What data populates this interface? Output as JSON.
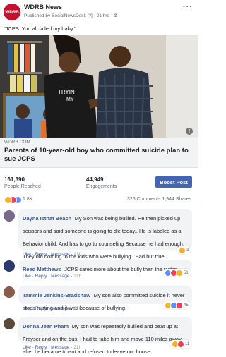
{
  "post": {
    "page_name": "WDRB News",
    "logo_text": "WDRB",
    "meta": "Published by SocialNewsDesk [?] · 21 hrs · ⚙",
    "more": "···",
    "text": "\"JCPS: You all failed my baby.\""
  },
  "photo": {
    "shirt_text_1": "TRYIN",
    "shirt_text_2": "MY",
    "info_icon": "i"
  },
  "link": {
    "domain": "WDRB.COM",
    "headline": "Parents of 10-year-old boy who committed suicide plan to sue JCPS"
  },
  "stats": {
    "reached_value": "161,390",
    "reached_label": "People Reached",
    "engagements_value": "44,949",
    "engagements_label": "Engagements",
    "boost_label": "Boost Post"
  },
  "reactions": {
    "count": "1.8K",
    "comments_shares": "326 Comments  1,944 Shares"
  },
  "comments": [
    {
      "name": "Dayna Isthat Beach",
      "text": "My Son was being bullied. He then picked up scissors and said someone is going to die today.. He is labeled as a Behavior child. And has to go to counseling Because he had enough. They did nothing to the kids who were bullying.. Sad but true.",
      "like": "Like",
      "reply": "Reply",
      "message": "Message",
      "time": "21h",
      "react_count": "3"
    },
    {
      "name": "Reed Matthews",
      "text": "JCPS cares more about the bully than the victim",
      "like": "Like",
      "reply": "Reply",
      "message": "Message",
      "time": "21h",
      "react_count": "51"
    },
    {
      "name": "Tammie Jenkins-Bradshaw",
      "text": "My son also committed suicide it never stops hurting and it was because of bullying.",
      "like": "Like",
      "reply": "Reply",
      "message": "Message",
      "time": "19h",
      "react_count": "45"
    },
    {
      "name": "Donna Jean Pham",
      "text": "My son was repeatedly bullied and beat up at Frayser and on the bus. I had to take him and move 110 miles away after he became truant and refused to leave our house.",
      "like": "Like",
      "reply": "Reply",
      "message": "Message",
      "time": "21h",
      "react_count": "11"
    }
  ],
  "colors": {
    "brand": "#c8102e",
    "link_blue": "#385898",
    "boost_blue": "#4267b2"
  }
}
